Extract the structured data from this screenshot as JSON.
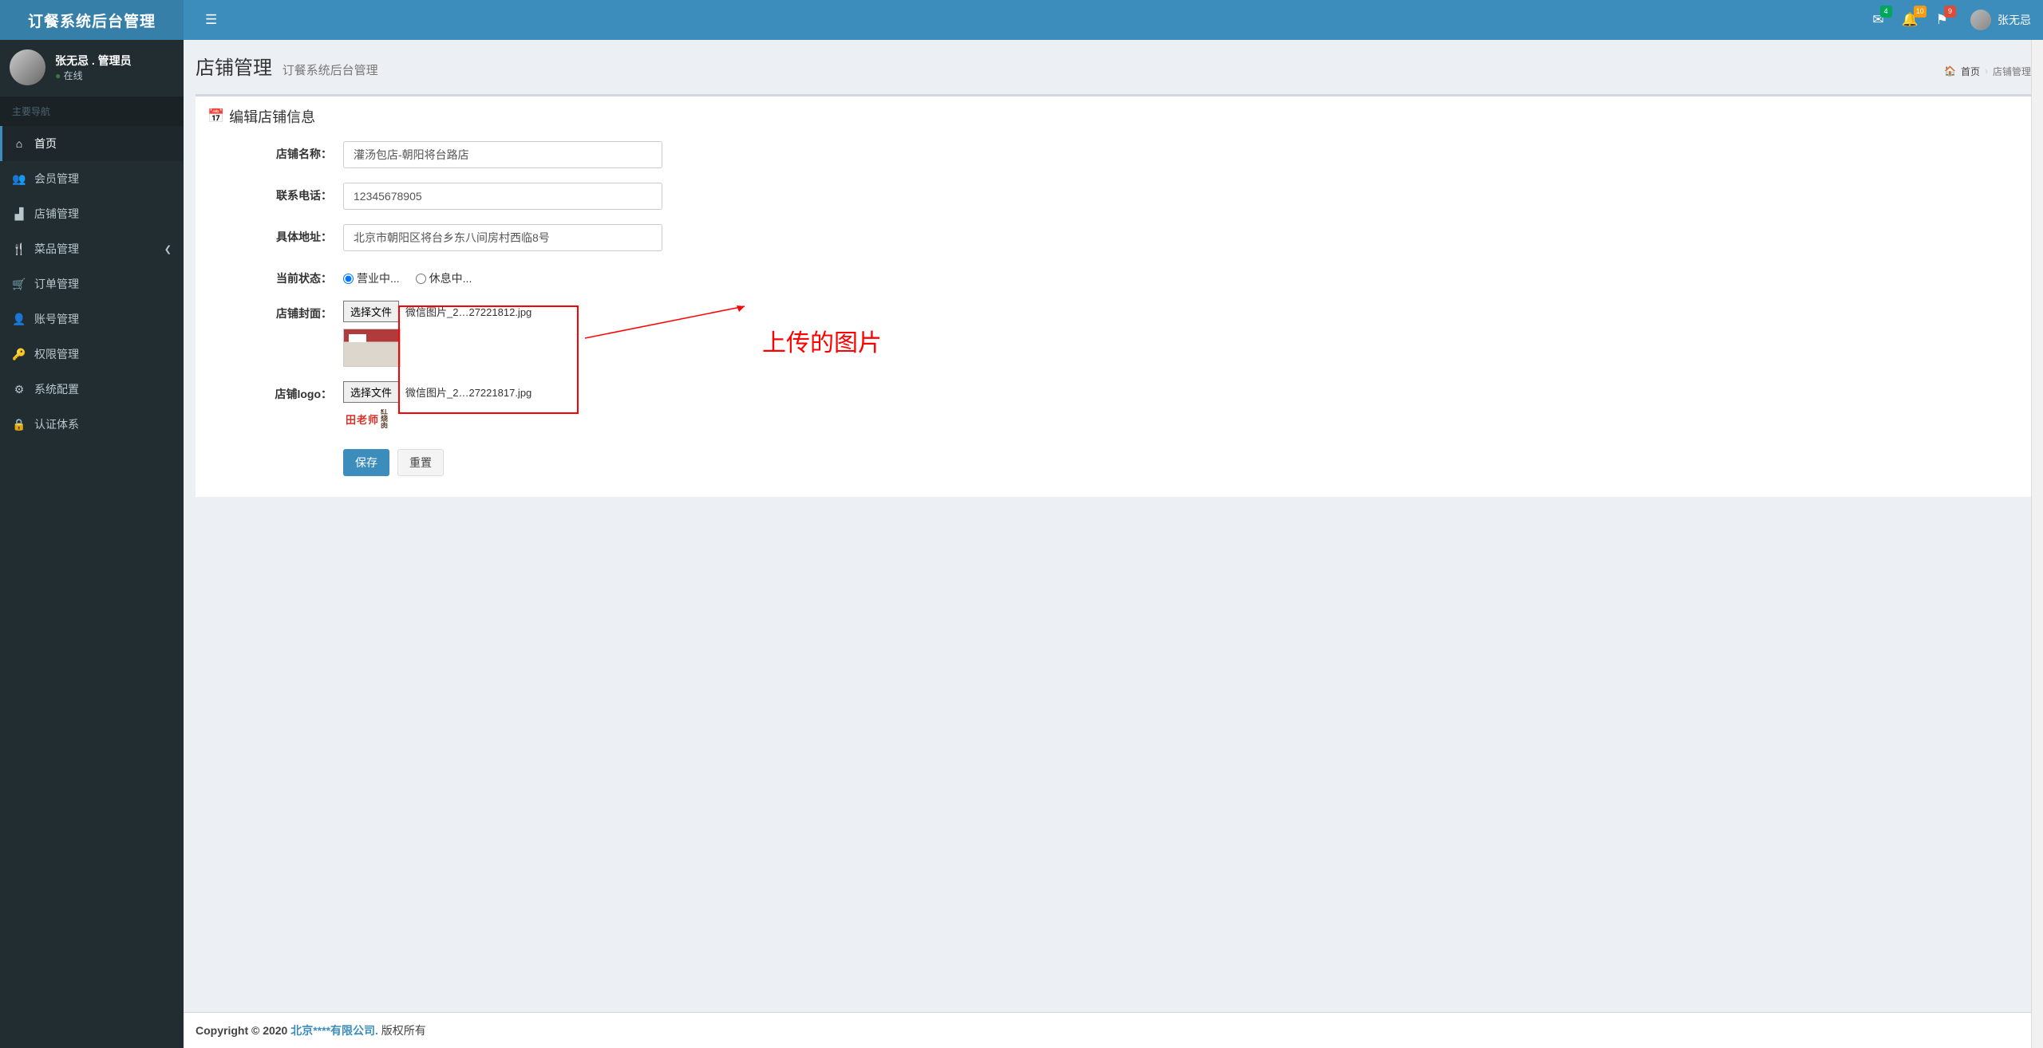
{
  "app_title": "订餐系统后台管理",
  "header": {
    "badges": {
      "mail": "4",
      "bell": "10",
      "flag": "9"
    },
    "user_name": "张无忌"
  },
  "sidebar": {
    "user_name": "张无忌",
    "user_role": "管理员",
    "status_text": "在线",
    "section_label": "主要导航",
    "items": [
      {
        "label": "首页"
      },
      {
        "label": "会员管理"
      },
      {
        "label": "店铺管理"
      },
      {
        "label": "菜品管理",
        "expandable": true
      },
      {
        "label": "订单管理"
      },
      {
        "label": "账号管理"
      },
      {
        "label": "权限管理"
      },
      {
        "label": "系统配置"
      },
      {
        "label": "认证体系"
      }
    ]
  },
  "page": {
    "title": "店铺管理",
    "subtitle": "订餐系统后台管理",
    "breadcrumb_home": "首页",
    "breadcrumb_current": "店铺管理"
  },
  "box_title": "编辑店铺信息",
  "form": {
    "name_label": "店铺名称：",
    "name_value": "灌汤包店-朝阳将台路店",
    "phone_label": "联系电话：",
    "phone_value": "12345678905",
    "address_label": "具体地址：",
    "address_value": "北京市朝阳区将台乡东八间房村西临8号",
    "status_label": "当前状态：",
    "status_opt_open": "营业中...",
    "status_opt_rest": "休息中...",
    "cover_label": "店铺封面：",
    "cover_file_btn": "选择文件",
    "cover_file_name": "微信图片_2…27221812.jpg",
    "logo_label": "店铺logo：",
    "logo_file_btn": "选择文件",
    "logo_file_name": "微信图片_2…27221817.jpg",
    "logo_preview_text": "田老师",
    "save_btn": "保存",
    "reset_btn": "重置"
  },
  "annotation_text": "上传的图片",
  "footer": {
    "prefix": "Copyright © 2020 ",
    "link": "北京****有限公司.",
    "suffix": " 版权所有"
  }
}
